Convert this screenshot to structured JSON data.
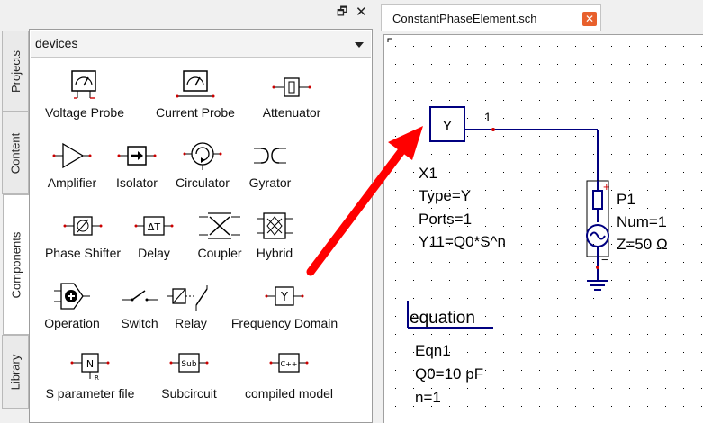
{
  "dock": {
    "float_icon": "🗗",
    "close_icon": "✕"
  },
  "vtabs": [
    {
      "label": "Projects",
      "active": false
    },
    {
      "label": "Content",
      "active": false
    },
    {
      "label": "Components",
      "active": true
    },
    {
      "label": "Library",
      "active": false
    }
  ],
  "category": {
    "selected": "devices"
  },
  "components": [
    {
      "label": "Voltage Probe",
      "icon": "voltage-probe-icon"
    },
    {
      "label": "Current Probe",
      "icon": "current-probe-icon"
    },
    {
      "label": "Attenuator",
      "icon": "attenuator-icon"
    },
    {
      "label": "Amplifier",
      "icon": "amplifier-icon"
    },
    {
      "label": "Isolator",
      "icon": "isolator-icon"
    },
    {
      "label": "Circulator",
      "icon": "circulator-icon"
    },
    {
      "label": "Gyrator",
      "icon": "gyrator-icon"
    },
    {
      "label": "Phase Shifter",
      "icon": "phase-shifter-icon"
    },
    {
      "label": "Delay",
      "icon": "delay-icon"
    },
    {
      "label": "Coupler",
      "icon": "coupler-icon"
    },
    {
      "label": "Hybrid",
      "icon": "hybrid-icon"
    },
    {
      "label": "Operation",
      "icon": "operation-icon"
    },
    {
      "label": "Switch",
      "icon": "switch-icon"
    },
    {
      "label": "Relay",
      "icon": "relay-icon"
    },
    {
      "label": "Frequency Domain",
      "icon": "frequency-domain-icon"
    },
    {
      "label": "S parameter file",
      "icon": "s-parameter-file-icon"
    },
    {
      "label": "Subcircuit",
      "icon": "subcircuit-icon"
    },
    {
      "label": "compiled model",
      "icon": "compiled-model-icon"
    }
  ],
  "icon_text": {
    "delay": "ΔT",
    "freq": "Y",
    "sparam": "N",
    "sparam_sub": "R",
    "sub": "Sub",
    "cpp": "C++"
  },
  "document": {
    "tab_label": "ConstantPhaseElement.sch",
    "tab_close": "✕"
  },
  "schematic": {
    "block_symbol": "Y",
    "pin_label": "1",
    "x1": {
      "name": "X1",
      "type": "Type=Y",
      "ports": "Ports=1",
      "param": "Y11=Q0*S^n"
    },
    "port": {
      "plus": "+",
      "minus": "−",
      "name": "P1",
      "num": "Num=1",
      "z": "Z=50 Ω"
    },
    "equation": {
      "title": "equation",
      "name": "Eqn1",
      "q0": "Q0=10 pF",
      "n": "n=1"
    }
  },
  "colors": {
    "wire": "#000080",
    "accent_red": "#ff0000",
    "tab_close": "#e8602c",
    "pin": "#d00000"
  }
}
